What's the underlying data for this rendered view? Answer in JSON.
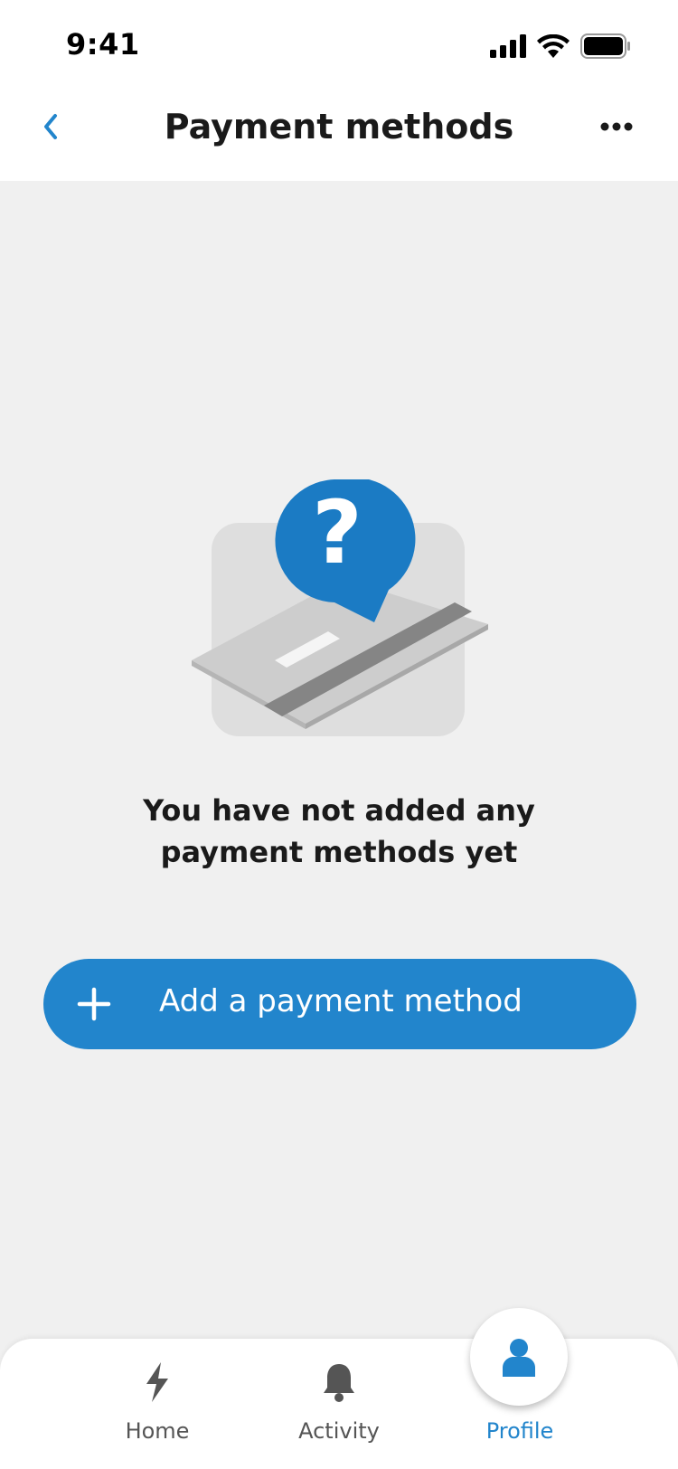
{
  "status_bar": {
    "time": "9:41"
  },
  "header": {
    "title": "Payment methods"
  },
  "empty_state": {
    "line1": "You have not added any",
    "line2": "payment methods yet"
  },
  "actions": {
    "add_payment_label": "Add a payment method"
  },
  "tabbar": {
    "items": [
      {
        "label": "Home",
        "icon": "lightning-icon"
      },
      {
        "label": "Activity",
        "icon": "bell-icon"
      },
      {
        "label": "Profile",
        "icon": "person-icon",
        "active": true
      }
    ]
  },
  "colors": {
    "accent": "#2285cc",
    "background": "#f0f0f0",
    "illustration_bubble": "#1b7bc4"
  }
}
